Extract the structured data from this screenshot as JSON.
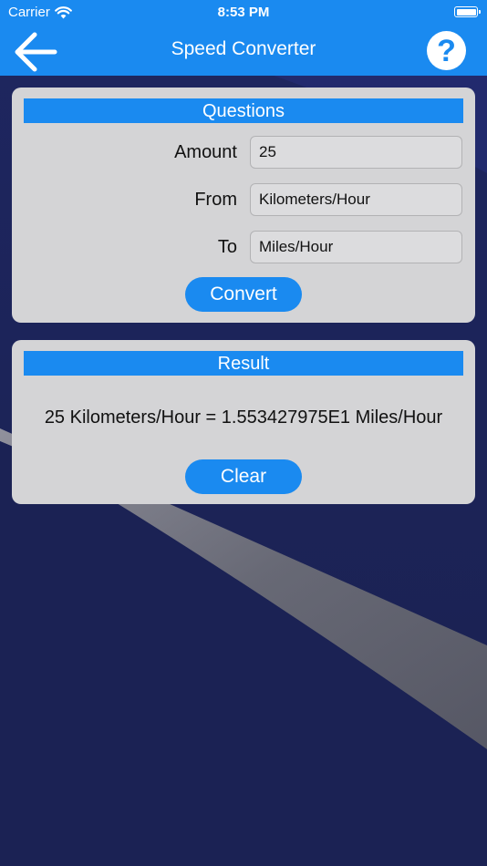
{
  "status_bar": {
    "carrier": "Carrier",
    "time": "8:53 PM"
  },
  "nav": {
    "title": "Speed Converter",
    "help_label": "?"
  },
  "questions": {
    "header": "Questions",
    "amount_label": "Amount",
    "amount_value": "25",
    "from_label": "From",
    "from_value": "Kilometers/Hour",
    "to_label": "To",
    "to_value": "Miles/Hour",
    "convert_label": "Convert"
  },
  "result": {
    "header": "Result",
    "text": "25 Kilometers/Hour = 1.553427975E1 Miles/Hour",
    "clear_label": "Clear"
  },
  "colors": {
    "accent": "#1a8af0",
    "card": "#d4d4d6",
    "background": "#1c2456"
  }
}
